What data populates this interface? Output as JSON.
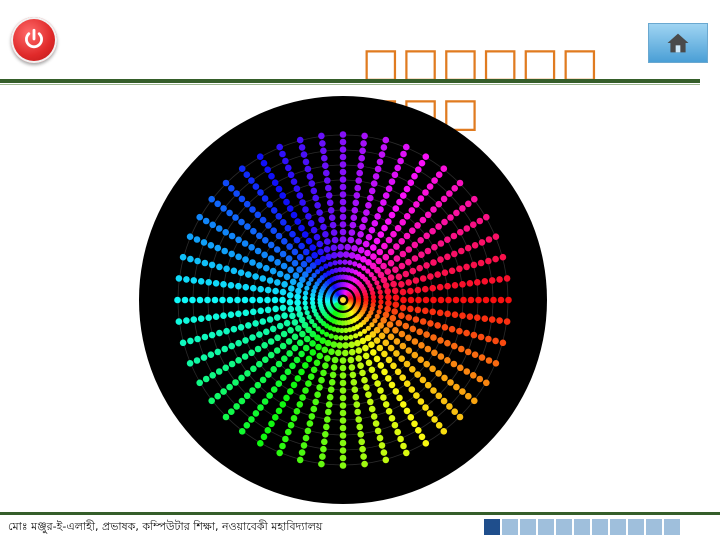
{
  "header": {
    "power_icon": "power-icon",
    "title": "□□□□□□□□□",
    "home_icon": "home-icon"
  },
  "colors": {
    "title": "#e07b20",
    "rule": "#355e2a",
    "power_button": "#e02a2a",
    "home_button": "#4a9fd6",
    "nav_active": "#1f4e8c",
    "nav_inactive": "#9fbfdc"
  },
  "main": {
    "image": "color-spiral-dot-wheel"
  },
  "footer": {
    "credit": "মোঃ মঞ্জুর-ই-এলাহী, প্রভাষক, কম্পিউটার শিক্ষা, নওয়াবেকী মহাবিদ্যালয়",
    "nav_squares": [
      true,
      false,
      false,
      false,
      false,
      false,
      false,
      false,
      false,
      false,
      false
    ]
  }
}
